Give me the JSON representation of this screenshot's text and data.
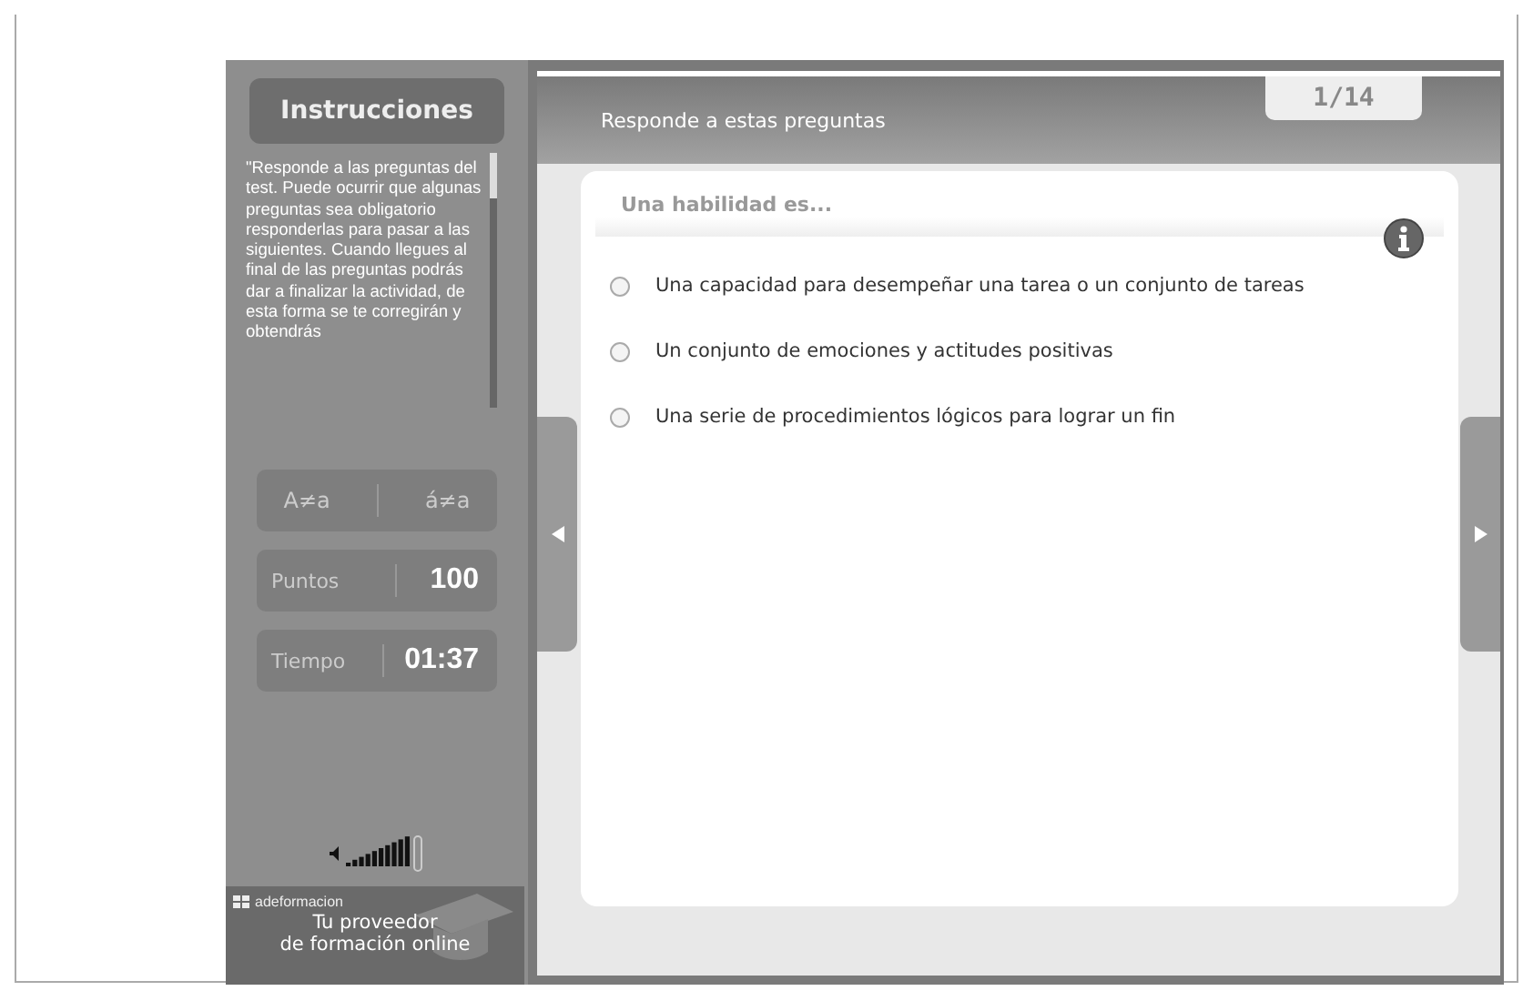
{
  "sidebar": {
    "title": "Instrucciones",
    "instructions": "\"Responde a las preguntas del test. Puede ocurrir que algunas preguntas sea obligatorio responderlas para pasar a las siguientes. Cuando llegues al final de las preguntas podrás dar a finalizar la actividad, de esta forma se te corregirán y obtendrás",
    "case_buttons": [
      "A≠a",
      "á≠a"
    ],
    "stats": [
      {
        "label": "Puntos",
        "value": "100"
      },
      {
        "label": "Tiempo",
        "value": "01:37"
      }
    ],
    "brand": {
      "name": "adeformacion",
      "tagline": [
        "Tu proveedor",
        "de formación online"
      ]
    }
  },
  "main": {
    "title": "Responde a estas preguntas",
    "counter": "1/14",
    "question": "Una habilidad es...",
    "options": [
      {
        "text": "Una capacidad para desempeñar una tarea o un conjunto de tareas",
        "selected": false
      },
      {
        "text": "Un conjunto de emociones  y actitudes positivas",
        "selected": false
      },
      {
        "text": "Una serie de procedimientos lógicos para lograr un fin",
        "selected": false
      }
    ]
  }
}
